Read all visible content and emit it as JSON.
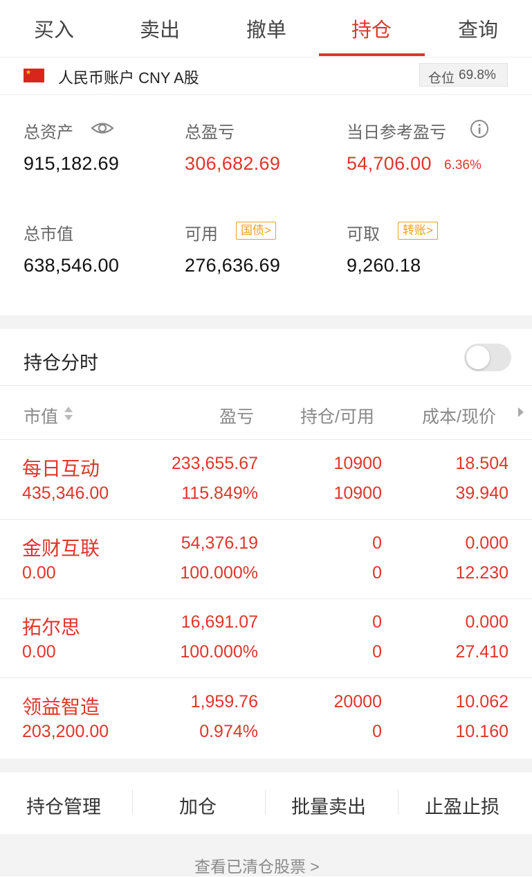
{
  "tabs": [
    "买入",
    "卖出",
    "撤单",
    "持仓",
    "查询"
  ],
  "active_tab": "持仓",
  "account": {
    "label": "人民币账户 CNY A股",
    "position_label": "仓位",
    "position_value": "69.8%"
  },
  "summary": {
    "total_assets_label": "总资产",
    "total_assets": "915,182.69",
    "total_pnl_label": "总盈亏",
    "total_pnl": "306,682.69",
    "daily_pnl_label": "当日参考盈亏",
    "daily_pnl": "54,706.00",
    "daily_pnl_pct": "6.36%",
    "market_value_label": "总市值",
    "market_value": "638,546.00",
    "available_label": "可用",
    "available": "276,636.69",
    "bond_button": "国债>",
    "withdrawable_label": "可取",
    "withdrawable": "9,260.18",
    "transfer_button": "转账>"
  },
  "intraday": {
    "label": "持仓分时",
    "enabled": false
  },
  "table": {
    "headers": [
      "市值",
      "盈亏",
      "持仓/可用",
      "成本/现价"
    ],
    "rows": [
      {
        "name": "每日互动",
        "market_value": "435,346.00",
        "pnl": "233,655.67",
        "pnl_pct": "115.849%",
        "holding": "10900",
        "available": "10900",
        "cost": "18.504",
        "price": "39.940"
      },
      {
        "name": "金财互联",
        "market_value": "0.00",
        "pnl": "54,376.19",
        "pnl_pct": "100.000%",
        "holding": "0",
        "available": "0",
        "cost": "0.000",
        "price": "12.230"
      },
      {
        "name": "拓尔思",
        "market_value": "0.00",
        "pnl": "16,691.07",
        "pnl_pct": "100.000%",
        "holding": "0",
        "available": "0",
        "cost": "0.000",
        "price": "27.410"
      },
      {
        "name": "领益智造",
        "market_value": "203,200.00",
        "pnl": "1,959.76",
        "pnl_pct": "0.974%",
        "holding": "20000",
        "available": "0",
        "cost": "10.062",
        "price": "10.160"
      }
    ]
  },
  "actions": [
    "持仓管理",
    "加仓",
    "批量卖出",
    "止盈止损"
  ],
  "footer_link": "查看已清仓股票 >",
  "colors": {
    "accent": "#e0352b",
    "warning": "#e8a317",
    "muted": "#888888"
  },
  "icons": [
    "eye-icon",
    "info-icon",
    "sort-icon",
    "chevron-right-icon",
    "china-flag-icon"
  ]
}
